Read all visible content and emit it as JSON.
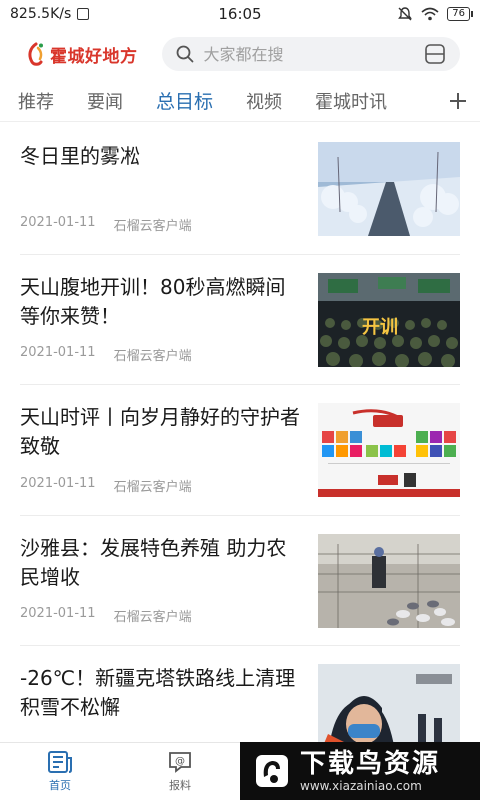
{
  "status_bar": {
    "speed": "825.5K/s",
    "time": "16:05",
    "battery": "76"
  },
  "header": {
    "app_name": "霍城好地方",
    "search_placeholder": "大家都在搜"
  },
  "tabs": [
    "推荐",
    "要闻",
    "总目标",
    "视频",
    "霍城时讯"
  ],
  "active_tab": "总目标",
  "articles": [
    {
      "title": "冬日里的雾凇",
      "date": "2021-01-11",
      "source": "石榴云客户端"
    },
    {
      "title": "天山腹地开训！80秒高燃瞬间等你来赞！",
      "date": "2021-01-11",
      "source": "石榴云客户端",
      "thumb_caption": "开训"
    },
    {
      "title": "天山时评丨向岁月静好的守护者致敬",
      "date": "2021-01-11",
      "source": "石榴云客户端"
    },
    {
      "title": "沙雅县：发展特色养殖 助力农民增收",
      "date": "2021-01-11",
      "source": "石榴云客户端"
    },
    {
      "title": "-26℃！新疆克塔铁路线上清理积雪不松懈",
      "date": "",
      "source": ""
    }
  ],
  "bottom_nav": {
    "home": "首页",
    "report": "报料"
  },
  "watermark": {
    "title": "下载鸟资源",
    "url": "www.xiazainiao.com"
  },
  "colors": {
    "accent": "#2a6fb1",
    "brand": "#d9362b"
  }
}
